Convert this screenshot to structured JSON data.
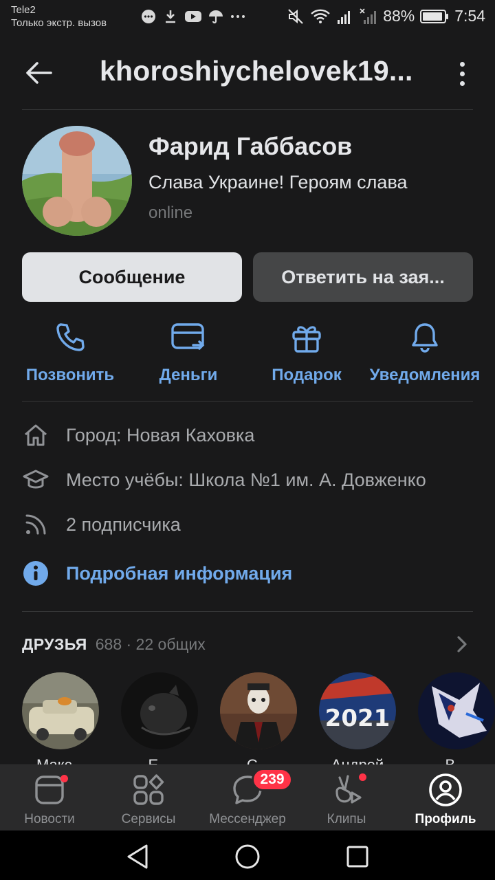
{
  "status_bar": {
    "carrier": "Tele2",
    "carrier_note": "Только экстр. вызов",
    "battery": "88%",
    "time": "7:54"
  },
  "header": {
    "title": "khoroshiychelovek19..."
  },
  "profile": {
    "name": "Фарид Габбасов",
    "status": "Слава Украине! Героям слава",
    "online": "online"
  },
  "buttons": {
    "message": "Сообщение",
    "reply_request": "Ответить на зая..."
  },
  "actions": [
    {
      "label": "Позвонить",
      "icon": "phone-icon"
    },
    {
      "label": "Деньги",
      "icon": "money-transfer-icon"
    },
    {
      "label": "Подарок",
      "icon": "gift-icon"
    },
    {
      "label": "Уведомления",
      "icon": "bell-icon"
    }
  ],
  "info": {
    "city": "Город: Новая Каховка",
    "school": "Место учёбы: Школа №1 им. А. Довженко",
    "followers": "2 подписчика",
    "details_link": "Подробная информация"
  },
  "friends": {
    "title": "ДРУЗЬЯ",
    "count": "688 · 22 общих",
    "names": [
      "Макс...",
      "Е...",
      "С...",
      "Андрей",
      "В..."
    ]
  },
  "tabbar": {
    "tabs": [
      {
        "label": "Новости",
        "icon": "news-icon"
      },
      {
        "label": "Сервисы",
        "icon": "services-icon"
      },
      {
        "label": "Мессенджер",
        "icon": "messenger-icon"
      },
      {
        "label": "Клипы",
        "icon": "clips-icon"
      },
      {
        "label": "Профиль",
        "icon": "profile-icon"
      }
    ],
    "messenger_badge": "239"
  },
  "colors": {
    "accent": "#71aaeb",
    "background": "#19191a",
    "badge": "#ff3347"
  }
}
